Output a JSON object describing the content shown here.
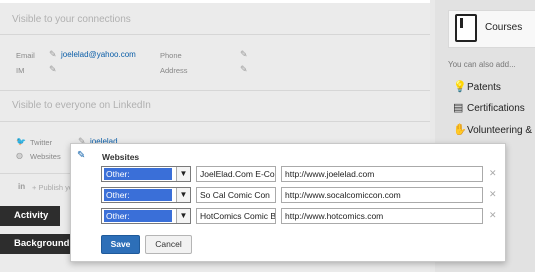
{
  "connections_section": {
    "title": "Visible to your connections",
    "email_label": "Email",
    "email_value": "joelelad@yahoo.com",
    "im_label": "IM",
    "phone_label": "Phone",
    "address_label": "Address"
  },
  "public_section": {
    "title": "Visible to everyone on LinkedIn",
    "twitter_label": "Twitter",
    "twitter_value": "joelelad",
    "websites_label": "Websites",
    "publish_hint": "+ Publish your pub"
  },
  "buttons": {
    "activity": "Activity",
    "background": "Background"
  },
  "sidebar": {
    "courses_label": "Courses",
    "also_add": "You can also add...",
    "items": [
      {
        "label": "Patents",
        "icon": "bulb-icon"
      },
      {
        "label": "Certifications",
        "icon": "certificate-icon"
      },
      {
        "label": "Volunteering &",
        "icon": "hand-icon"
      }
    ]
  },
  "websites_modal": {
    "title": "Websites",
    "rows": [
      {
        "type": "Other:",
        "name": "JoelElad.Com E-Co",
        "url": "http://www.joelelad.com"
      },
      {
        "type": "Other:",
        "name": "So Cal Comic Con",
        "url": "http://www.socalcomiccon.com"
      },
      {
        "type": "Other:",
        "name": "HotComics Comic B",
        "url": "http://www.hotcomics.com"
      }
    ],
    "save_label": "Save",
    "cancel_label": "Cancel"
  },
  "colors": {
    "link": "#0b5ea8",
    "save_button": "#2d6fb8",
    "dark_button": "#2d2d2d",
    "select_highlight": "#3a6fd8"
  }
}
